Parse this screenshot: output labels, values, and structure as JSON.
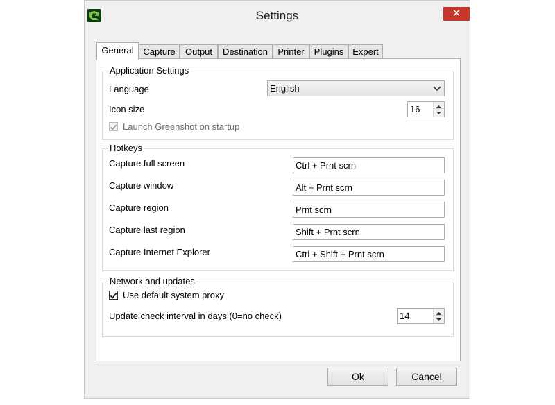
{
  "window": {
    "title": "Settings",
    "close_label": "✕"
  },
  "tabs": [
    {
      "label": "General",
      "active": true
    },
    {
      "label": "Capture"
    },
    {
      "label": "Output"
    },
    {
      "label": "Destination"
    },
    {
      "label": "Printer"
    },
    {
      "label": "Plugins"
    },
    {
      "label": "Expert"
    }
  ],
  "application_settings": {
    "legend": "Application Settings",
    "language_label": "Language",
    "language_value": "English",
    "icon_size_label": "Icon size",
    "icon_size_value": "16",
    "launch_label": "Launch Greenshot on startup",
    "launch_checked": true,
    "launch_disabled": true
  },
  "hotkeys": {
    "legend": "Hotkeys",
    "items": [
      {
        "label": "Capture full screen",
        "value": "Ctrl + Prnt scrn"
      },
      {
        "label": "Capture window",
        "value": "Alt + Prnt scrn"
      },
      {
        "label": "Capture region",
        "value": "Prnt scrn"
      },
      {
        "label": "Capture last region",
        "value": "Shift + Prnt scrn"
      },
      {
        "label": "Capture Internet Explorer",
        "value": "Ctrl + Shift + Prnt scrn"
      }
    ]
  },
  "network": {
    "legend": "Network and updates",
    "proxy_label": "Use default system proxy",
    "proxy_checked": true,
    "interval_label": "Update check interval in days (0=no check)",
    "interval_value": "14"
  },
  "buttons": {
    "ok": "Ok",
    "cancel": "Cancel"
  }
}
